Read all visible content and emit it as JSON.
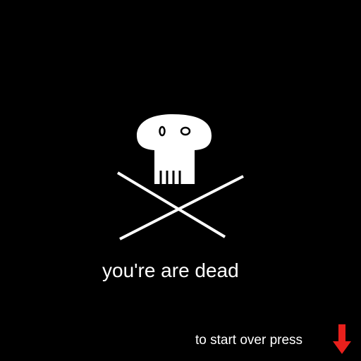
{
  "game_over": {
    "message": "you're are dead",
    "restart_prompt": "to start over press"
  },
  "icons": {
    "emblem": "skull-and-crossbones-icon",
    "restart": "down-arrow-icon"
  },
  "colors": {
    "background": "#000000",
    "foreground": "#ffffff",
    "arrow": "#e8201c"
  }
}
